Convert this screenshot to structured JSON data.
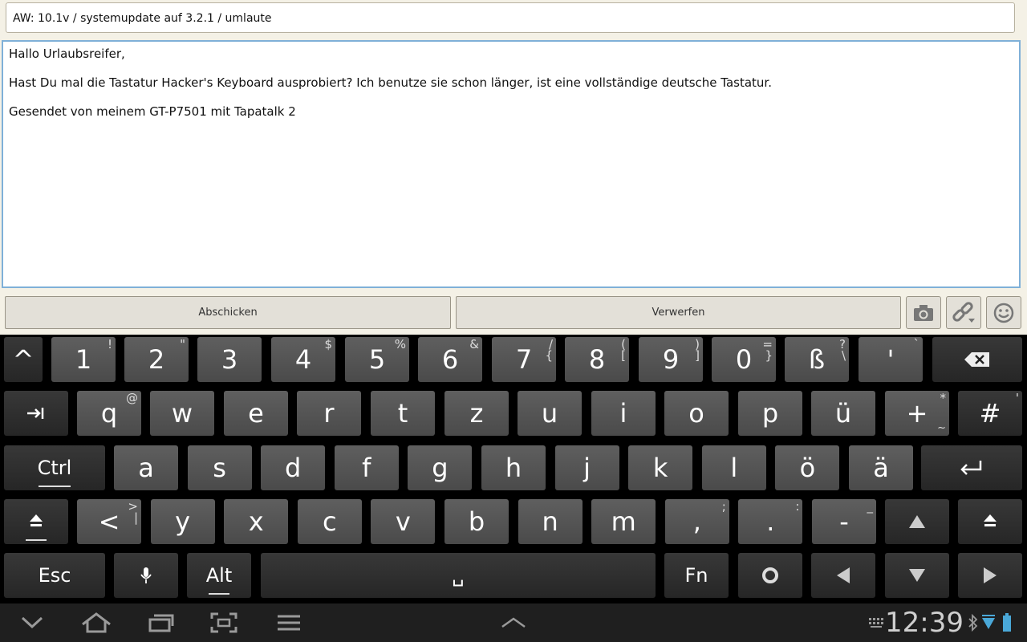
{
  "compose": {
    "subject": "AW: 10.1v / systemupdate auf 3.2.1 / umlaute",
    "body_lines": [
      "Hallo Urlaubsreifer,",
      "Hast Du mal die Tastatur Hacker's Keyboard ausprobiert? Ich benutze sie schon länger, ist eine vollständige deutsche Tastatur.",
      "Gesendet von meinem GT-P7501 mit Tapatalk 2"
    ]
  },
  "actions": {
    "send_label": "Abschicken",
    "discard_label": "Verwerfen",
    "icons": [
      "camera-icon",
      "link-icon",
      "smiley-icon"
    ]
  },
  "keyboard": {
    "row1": [
      {
        "label": "^",
        "alt": ""
      },
      {
        "label": "1",
        "alt": "!"
      },
      {
        "label": "2",
        "alt": "\""
      },
      {
        "label": "3",
        "alt": ""
      },
      {
        "label": "4",
        "alt": "$"
      },
      {
        "label": "5",
        "alt": "%"
      },
      {
        "label": "6",
        "alt": "&"
      },
      {
        "label": "7",
        "alt": "/",
        "alt2": "{"
      },
      {
        "label": "8",
        "alt": "(",
        "alt2": "["
      },
      {
        "label": "9",
        "alt": ")",
        "alt2": "]"
      },
      {
        "label": "0",
        "alt": "=",
        "alt2": "}"
      },
      {
        "label": "ß",
        "alt": "?",
        "alt2": "\\"
      },
      {
        "label": "'",
        "alt": "`"
      }
    ],
    "row2": [
      {
        "label": "q",
        "alt": "@"
      },
      {
        "label": "w",
        "alt": ""
      },
      {
        "label": "e",
        "alt": ""
      },
      {
        "label": "r",
        "alt": ""
      },
      {
        "label": "t",
        "alt": ""
      },
      {
        "label": "z",
        "alt": ""
      },
      {
        "label": "u",
        "alt": ""
      },
      {
        "label": "i",
        "alt": ""
      },
      {
        "label": "o",
        "alt": ""
      },
      {
        "label": "p",
        "alt": ""
      },
      {
        "label": "ü",
        "alt": ""
      },
      {
        "label": "+",
        "alt": "*",
        "alt2": "~"
      },
      {
        "label": "#",
        "alt": "'"
      }
    ],
    "row3": [
      {
        "label": "a"
      },
      {
        "label": "s"
      },
      {
        "label": "d"
      },
      {
        "label": "f"
      },
      {
        "label": "g"
      },
      {
        "label": "h"
      },
      {
        "label": "j"
      },
      {
        "label": "k"
      },
      {
        "label": "l"
      },
      {
        "label": "ö"
      },
      {
        "label": "ä"
      }
    ],
    "row4": [
      {
        "label": "<",
        "alt": ">",
        "alt2": "|"
      },
      {
        "label": "y",
        "alt": ""
      },
      {
        "label": "x",
        "alt": ""
      },
      {
        "label": "c",
        "alt": ""
      },
      {
        "label": "v",
        "alt": ""
      },
      {
        "label": "b",
        "alt": ""
      },
      {
        "label": "n",
        "alt": ""
      },
      {
        "label": "m",
        "alt": ""
      },
      {
        "label": ",",
        "alt": ";"
      },
      {
        "label": ".",
        "alt": ":"
      },
      {
        "label": "-",
        "alt": "_"
      }
    ],
    "ctrl_label": "Ctrl",
    "esc_label": "Esc",
    "alt_label": "Alt",
    "fn_label": "Fn",
    "space_label": "␣"
  },
  "status": {
    "time": "12:39"
  }
}
